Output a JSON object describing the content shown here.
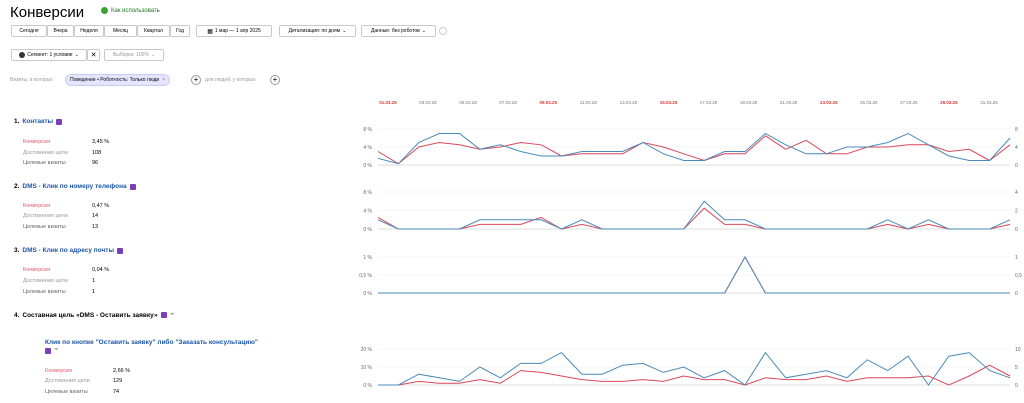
{
  "header": {
    "title": "Конверсии",
    "howto": "Как использовать"
  },
  "toolbar": {
    "periods": [
      "Сегодня",
      "Вчера",
      "Неделя",
      "Месяц",
      "Квартал",
      "Год"
    ],
    "date_range": "1 мар — 1 апр 2025",
    "detail": "Детализация: по дням",
    "data": "Данные: без роботов"
  },
  "segment": {
    "label": "Сегмент: 1 условие",
    "sample": "Выборка: 100%"
  },
  "filter": {
    "prefix": "Визиты, в которых",
    "chip": "Поведение • Роботность: Только люди",
    "suffix": "для людей, у которых"
  },
  "dates": [
    {
      "label": "01.03.25",
      "weekend": true
    },
    {
      "label": "03.03.25",
      "weekend": false
    },
    {
      "label": "05.03.25",
      "weekend": false
    },
    {
      "label": "07.03.25",
      "weekend": false
    },
    {
      "label": "09.03.25",
      "weekend": true
    },
    {
      "label": "11.03.25",
      "weekend": false
    },
    {
      "label": "13.03.25",
      "weekend": false
    },
    {
      "label": "15.03.25",
      "weekend": true
    },
    {
      "label": "17.03.25",
      "weekend": false
    },
    {
      "label": "19.03.25",
      "weekend": false
    },
    {
      "label": "21.03.25",
      "weekend": false
    },
    {
      "label": "23.03.25",
      "weekend": true
    },
    {
      "label": "25.03.25",
      "weekend": false
    },
    {
      "label": "27.03.25",
      "weekend": false
    },
    {
      "label": "29.03.25",
      "weekend": true
    },
    {
      "label": "31.03.25",
      "weekend": false
    }
  ],
  "metric_labels": {
    "conversion": "Конверсия",
    "achievements": "Достижения цели",
    "visits": "Целевые визиты"
  },
  "goals": [
    {
      "index": "1.",
      "name": "Контакты",
      "conversion": "3,45 %",
      "achievements": "108",
      "visits": "96"
    },
    {
      "index": "2.",
      "name": "DMS - Клик по номеру телефона",
      "conversion": "0,47 %",
      "achievements": "14",
      "visits": "13"
    },
    {
      "index": "3.",
      "name": "DMS - Клик по адресу почты",
      "conversion": "0,04 %",
      "achievements": "1",
      "visits": "1"
    },
    {
      "index": "4.",
      "name": "Составная цель «DMS - Оставить заявку»"
    }
  ],
  "subgoal": {
    "name": "Клик по кнопке \"Оставить заявку\" либо \"Заказать консультацию\"",
    "conversion": "2,66 %",
    "achievements": "129",
    "visits": "74"
  },
  "colors": {
    "conversion_line": "#d9475a",
    "visits_line": "#4a8ab8",
    "link": "#1c56a7",
    "weekend": "#d33333"
  },
  "chart_data": [
    {
      "type": "line",
      "name": "Контакты",
      "x": [
        "01.03.25",
        "02.03.25",
        "03.03.25",
        "04.03.25",
        "05.03.25",
        "06.03.25",
        "07.03.25",
        "08.03.25",
        "09.03.25",
        "10.03.25",
        "11.03.25",
        "12.03.25",
        "13.03.25",
        "14.03.25",
        "15.03.25",
        "16.03.25",
        "17.03.25",
        "18.03.25",
        "19.03.25",
        "20.03.25",
        "21.03.25",
        "22.03.25",
        "23.03.25",
        "24.03.25",
        "25.03.25",
        "26.03.25",
        "27.03.25",
        "28.03.25",
        "29.03.25",
        "30.03.25",
        "31.03.25",
        "01.04.25"
      ],
      "left_ticks": [
        "8 %",
        "4 %",
        "0 %"
      ],
      "right_ticks": [
        "8",
        "4",
        "0"
      ],
      "ylim_left": [
        0,
        8
      ],
      "ylim_right": [
        0,
        8
      ],
      "series": [
        {
          "values": [
            3,
            0.3,
            4,
            5,
            4.5,
            3.5,
            4,
            5,
            4.5,
            2,
            2.5,
            2.5,
            2.5,
            5,
            4,
            2.5,
            1,
            2.5,
            2.5,
            6.5,
            3.5,
            5.5,
            2.5,
            2.5,
            4,
            4,
            4.5,
            4.5,
            3,
            3.5,
            1,
            4.5
          ]
        },
        {
          "values": [
            1.5,
            0.3,
            5,
            7,
            7,
            3.5,
            4.5,
            3,
            2,
            2,
            3,
            3,
            3,
            5,
            2.5,
            1,
            1,
            3,
            3,
            7,
            4.5,
            2.5,
            2.5,
            4,
            4,
            5,
            7,
            4.5,
            2,
            1,
            1,
            6
          ]
        }
      ]
    },
    {
      "type": "line",
      "name": "DMS - Клик по номеру телефона",
      "left_ticks": [
        "8 %",
        "4 %",
        "0 %"
      ],
      "right_ticks": [
        "4",
        "2",
        "0"
      ],
      "ylim_left": [
        0,
        8
      ],
      "ylim_right": [
        0,
        4
      ],
      "series": [
        {
          "values": [
            2.5,
            0,
            0,
            0,
            0,
            1,
            1,
            1,
            2.5,
            0,
            1,
            0,
            0,
            0,
            0,
            0,
            4.5,
            1,
            1,
            0,
            0,
            0,
            0,
            0,
            0,
            1,
            0,
            1,
            0,
            0,
            0,
            1
          ]
        },
        {
          "values": [
            2,
            0,
            0,
            0,
            0,
            2,
            2,
            2,
            2,
            0,
            2,
            0,
            0,
            0,
            0,
            0,
            6,
            2,
            2,
            0,
            0,
            0,
            0,
            0,
            0,
            2,
            0,
            2,
            0,
            0,
            0,
            2
          ]
        }
      ]
    },
    {
      "type": "line",
      "name": "DMS - Клик по адресу почты",
      "left_ticks": [
        "1 %",
        "0,5 %",
        "0 %"
      ],
      "right_ticks": [
        "1",
        "0,5",
        "0"
      ],
      "ylim_left": [
        0,
        1
      ],
      "ylim_right": [
        0,
        1
      ],
      "series": [
        {
          "values": [
            0,
            0,
            0,
            0,
            0,
            0,
            0,
            0,
            0,
            0,
            0,
            0,
            0,
            0,
            0,
            0,
            0,
            0,
            1,
            0,
            0,
            0,
            0,
            0,
            0,
            0,
            0,
            0,
            0,
            0,
            0,
            0
          ]
        },
        {
          "values": [
            0,
            0,
            0,
            0,
            0,
            0,
            0,
            0,
            0,
            0,
            0,
            0,
            0,
            0,
            0,
            0,
            0,
            0,
            1,
            0,
            0,
            0,
            0,
            0,
            0,
            0,
            0,
            0,
            0,
            0,
            0,
            0
          ]
        }
      ]
    },
    {
      "type": "line",
      "name": "Клик по кнопке \"Оставить заявку\" либо \"Заказать консультацию\"",
      "left_ticks": [
        "20 %",
        "10 %",
        "0 %"
      ],
      "right_ticks": [
        "10",
        "5",
        "0"
      ],
      "ylim_left": [
        0,
        20
      ],
      "ylim_right": [
        0,
        10
      ],
      "series": [
        {
          "values": [
            0,
            0,
            2,
            1,
            1,
            3,
            1,
            8,
            7,
            5,
            3,
            2,
            2,
            3,
            2,
            5,
            3,
            3,
            0,
            4,
            3,
            3,
            5,
            2,
            4,
            4,
            4,
            5,
            0,
            5,
            11,
            5
          ]
        },
        {
          "values": [
            0,
            0,
            6,
            4,
            2,
            10,
            4,
            12,
            12,
            18,
            6,
            6,
            11,
            12,
            7,
            10,
            4,
            8,
            0,
            18,
            4,
            6,
            8,
            4,
            14,
            8,
            16,
            0,
            16,
            18,
            8,
            4
          ]
        }
      ]
    }
  ]
}
